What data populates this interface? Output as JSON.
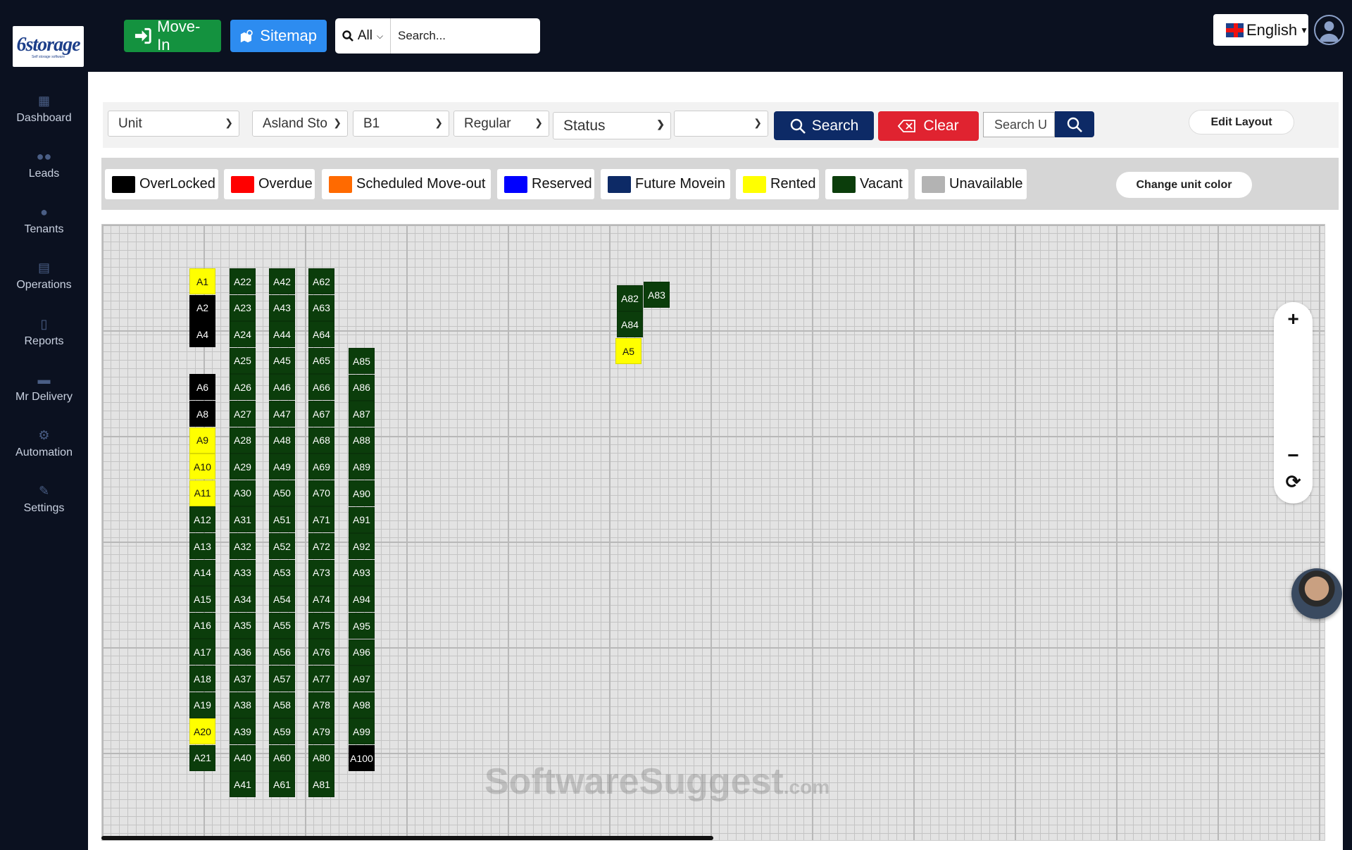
{
  "topbar": {
    "logo_text": "6storage",
    "logo_tagline": "Self storage software",
    "movein_label": "Move-In",
    "sitemap_label": "Sitemap",
    "search_scope": "All",
    "search_placeholder": "Search...",
    "language": "English"
  },
  "sidebar": {
    "items": [
      {
        "label": "Dashboard",
        "icon": "dashboard-icon"
      },
      {
        "label": "Leads",
        "icon": "users-icon"
      },
      {
        "label": "Tenants",
        "icon": "tenants-icon"
      },
      {
        "label": "Operations",
        "icon": "clipboard-icon"
      },
      {
        "label": "Reports",
        "icon": "file-icon"
      },
      {
        "label": "Mr Delivery",
        "icon": "truck-icon"
      },
      {
        "label": "Automation",
        "icon": "gears-icon"
      },
      {
        "label": "Settings",
        "icon": "wrench-icon"
      }
    ]
  },
  "filters": {
    "type": "Unit",
    "facility": "Asland Sto",
    "building": "B1",
    "category": "Regular",
    "status": "Status",
    "extra": "",
    "search_label": "Search",
    "clear_label": "Clear",
    "unit_search_placeholder": "Search U",
    "edit_layout_label": "Edit Layout"
  },
  "legend": {
    "items": [
      {
        "label": "OverLocked",
        "color": "#000000"
      },
      {
        "label": "Overdue",
        "color": "#ff0000"
      },
      {
        "label": "Scheduled Move-out",
        "color": "#ff6a00"
      },
      {
        "label": "Reserved",
        "color": "#0000ff"
      },
      {
        "label": "Future Movein",
        "color": "#0d2a66"
      },
      {
        "label": "Rented",
        "color": "#ffff00"
      },
      {
        "label": "Vacant",
        "color": "#0b3d0b"
      },
      {
        "label": "Unavailable",
        "color": "#b3b3b3"
      }
    ],
    "change_color_label": "Change unit color"
  },
  "status_colors": {
    "vacant": "#0b3d0b",
    "rented": "#ffff00",
    "overlocked": "#000000"
  },
  "units": [
    {
      "id": "A1",
      "status": "rented"
    },
    {
      "id": "A2",
      "status": "overlocked"
    },
    {
      "id": "A4",
      "status": "overlocked"
    },
    {
      "id": "A6",
      "status": "overlocked"
    },
    {
      "id": "A8",
      "status": "overlocked"
    },
    {
      "id": "A9",
      "status": "rented"
    },
    {
      "id": "A10",
      "status": "rented"
    },
    {
      "id": "A11",
      "status": "rented"
    },
    {
      "id": "A12",
      "status": "vacant"
    },
    {
      "id": "A13",
      "status": "vacant"
    },
    {
      "id": "A14",
      "status": "vacant"
    },
    {
      "id": "A15",
      "status": "vacant"
    },
    {
      "id": "A16",
      "status": "vacant"
    },
    {
      "id": "A17",
      "status": "vacant"
    },
    {
      "id": "A18",
      "status": "vacant"
    },
    {
      "id": "A19",
      "status": "vacant"
    },
    {
      "id": "A20",
      "status": "rented"
    },
    {
      "id": "A21",
      "status": "vacant"
    },
    {
      "id": "A22",
      "status": "vacant"
    },
    {
      "id": "A23",
      "status": "vacant"
    },
    {
      "id": "A24",
      "status": "vacant"
    },
    {
      "id": "A25",
      "status": "vacant"
    },
    {
      "id": "A26",
      "status": "vacant"
    },
    {
      "id": "A27",
      "status": "vacant"
    },
    {
      "id": "A28",
      "status": "vacant"
    },
    {
      "id": "A29",
      "status": "vacant"
    },
    {
      "id": "A30",
      "status": "vacant"
    },
    {
      "id": "A31",
      "status": "vacant"
    },
    {
      "id": "A32",
      "status": "vacant"
    },
    {
      "id": "A33",
      "status": "vacant"
    },
    {
      "id": "A34",
      "status": "vacant"
    },
    {
      "id": "A35",
      "status": "vacant"
    },
    {
      "id": "A36",
      "status": "vacant"
    },
    {
      "id": "A37",
      "status": "vacant"
    },
    {
      "id": "A38",
      "status": "vacant"
    },
    {
      "id": "A39",
      "status": "vacant"
    },
    {
      "id": "A40",
      "status": "vacant"
    },
    {
      "id": "A41",
      "status": "vacant"
    },
    {
      "id": "A42",
      "status": "vacant"
    },
    {
      "id": "A43",
      "status": "vacant"
    },
    {
      "id": "A44",
      "status": "vacant"
    },
    {
      "id": "A45",
      "status": "vacant"
    },
    {
      "id": "A46",
      "status": "vacant"
    },
    {
      "id": "A47",
      "status": "vacant"
    },
    {
      "id": "A48",
      "status": "vacant"
    },
    {
      "id": "A49",
      "status": "vacant"
    },
    {
      "id": "A50",
      "status": "vacant"
    },
    {
      "id": "A51",
      "status": "vacant"
    },
    {
      "id": "A52",
      "status": "vacant"
    },
    {
      "id": "A53",
      "status": "vacant"
    },
    {
      "id": "A54",
      "status": "vacant"
    },
    {
      "id": "A55",
      "status": "vacant"
    },
    {
      "id": "A56",
      "status": "vacant"
    },
    {
      "id": "A57",
      "status": "vacant"
    },
    {
      "id": "A58",
      "status": "vacant"
    },
    {
      "id": "A59",
      "status": "vacant"
    },
    {
      "id": "A60",
      "status": "vacant"
    },
    {
      "id": "A61",
      "status": "vacant"
    },
    {
      "id": "A62",
      "status": "vacant"
    },
    {
      "id": "A63",
      "status": "vacant"
    },
    {
      "id": "A64",
      "status": "vacant"
    },
    {
      "id": "A65",
      "status": "vacant"
    },
    {
      "id": "A66",
      "status": "vacant"
    },
    {
      "id": "A67",
      "status": "vacant"
    },
    {
      "id": "A68",
      "status": "vacant"
    },
    {
      "id": "A69",
      "status": "vacant"
    },
    {
      "id": "A70",
      "status": "vacant"
    },
    {
      "id": "A71",
      "status": "vacant"
    },
    {
      "id": "A72",
      "status": "vacant"
    },
    {
      "id": "A73",
      "status": "vacant"
    },
    {
      "id": "A74",
      "status": "vacant"
    },
    {
      "id": "A75",
      "status": "vacant"
    },
    {
      "id": "A76",
      "status": "vacant"
    },
    {
      "id": "A77",
      "status": "vacant"
    },
    {
      "id": "A78",
      "status": "vacant"
    },
    {
      "id": "A79",
      "status": "vacant"
    },
    {
      "id": "A80",
      "status": "vacant"
    },
    {
      "id": "A81",
      "status": "vacant"
    },
    {
      "id": "A85",
      "status": "vacant"
    },
    {
      "id": "A86",
      "status": "vacant"
    },
    {
      "id": "A87",
      "status": "vacant"
    },
    {
      "id": "A88",
      "status": "vacant"
    },
    {
      "id": "A89",
      "status": "vacant"
    },
    {
      "id": "A90",
      "status": "vacant"
    },
    {
      "id": "A91",
      "status": "vacant"
    },
    {
      "id": "A92",
      "status": "vacant"
    },
    {
      "id": "A93",
      "status": "vacant"
    },
    {
      "id": "A94",
      "status": "vacant"
    },
    {
      "id": "A95",
      "status": "vacant"
    },
    {
      "id": "A96",
      "status": "vacant"
    },
    {
      "id": "A97",
      "status": "vacant"
    },
    {
      "id": "A98",
      "status": "vacant"
    },
    {
      "id": "A99",
      "status": "vacant"
    },
    {
      "id": "A100",
      "status": "overlocked"
    },
    {
      "id": "A82",
      "status": "vacant"
    },
    {
      "id": "A83",
      "status": "vacant"
    },
    {
      "id": "A84",
      "status": "vacant"
    },
    {
      "id": "A5",
      "status": "rented"
    }
  ],
  "zoom": {
    "in": "+",
    "out": "−",
    "reset": "⟳"
  },
  "watermark": {
    "main": "SoftwareSuggest",
    "suffix": ".com"
  }
}
